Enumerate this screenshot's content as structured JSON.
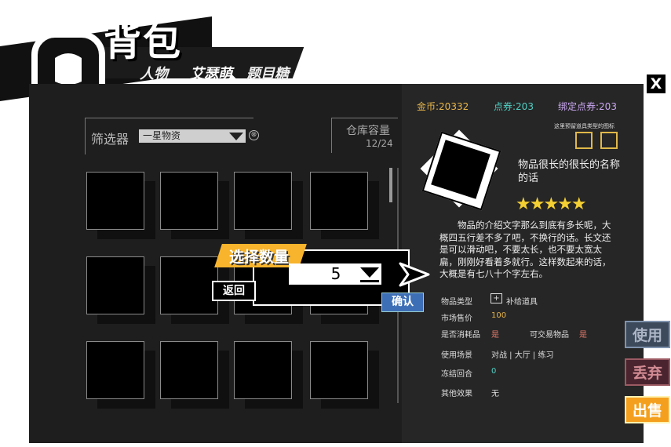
{
  "header": {
    "title": "背包",
    "tabs": [
      {
        "label": "人物"
      },
      {
        "label": "艾瑟萌"
      },
      {
        "label": "题目糖"
      }
    ]
  },
  "close_label": "X",
  "filter": {
    "label": "筛选器",
    "selected": "一星物资",
    "clear_icon": "⊗"
  },
  "capacity": {
    "label": "仓库容量",
    "value": "12/24"
  },
  "currency": {
    "gold": "金币:20332",
    "points": "点券:203",
    "bound": "绑定点券:203",
    "gold_color": "#e8b64a",
    "points_color": "#4fd1c5",
    "bound_color": "#c9a6f0"
  },
  "type_icon_tip": "这里预留道具类型的图标",
  "item": {
    "name": "物品很长的很长的名称的话",
    "stars": "★★★★★",
    "rating": 5,
    "description": "物品的介绍文字那么到底有多长呢，大概四五行差不多了吧，不换行的话。长文还是可以滑动吧，不要太长，也不要太宽太扁，刚刚好看着多就行。这样数起来的话，大概是有七八十个字左右。",
    "props": [
      {
        "key": "物品类型",
        "value": "补给道具"
      },
      {
        "key": "市场售价",
        "value": "100"
      },
      {
        "key": "是否消耗品",
        "value": "是"
      },
      {
        "key": "使用场景",
        "value": "对战 | 大厅 | 练习"
      },
      {
        "key": "冻结回合",
        "value": "0"
      },
      {
        "key": "其他效果",
        "value": "无"
      }
    ],
    "tradable_key": "可交易物品",
    "tradable_value": "是"
  },
  "actions": {
    "use": "使用",
    "discard": "丢弃",
    "sell": "出售"
  },
  "dialog": {
    "title": "选择数量",
    "quantity": "5",
    "back": "返回",
    "confirm": "确认"
  }
}
